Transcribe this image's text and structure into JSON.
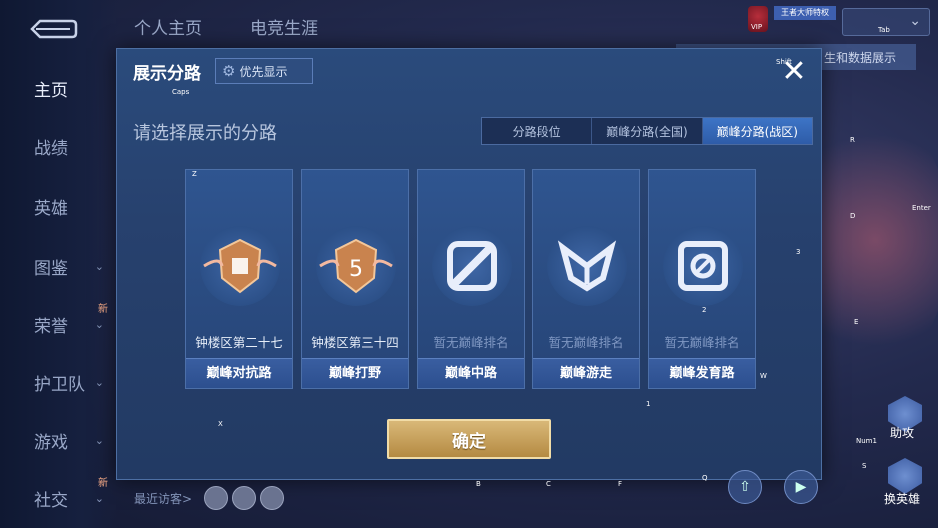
{
  "sidebar": {
    "items": [
      {
        "label": "主页",
        "active": true,
        "chevron": false,
        "new": false
      },
      {
        "label": "战绩",
        "active": false,
        "chevron": false,
        "new": false
      },
      {
        "label": "英雄",
        "active": false,
        "chevron": false,
        "new": false
      },
      {
        "label": "图鉴",
        "active": false,
        "chevron": true,
        "new": false
      },
      {
        "label": "荣誉",
        "active": false,
        "chevron": true,
        "new": true
      },
      {
        "label": "护卫队",
        "active": false,
        "chevron": true,
        "new": false
      },
      {
        "label": "游戏",
        "active": false,
        "chevron": true,
        "new": false
      },
      {
        "label": "社交",
        "active": false,
        "chevron": true,
        "new": true
      }
    ],
    "new_badge": "新"
  },
  "top_tabs": [
    "个人主页",
    "电竞生涯"
  ],
  "top_right": {
    "ribbon_text": "生和数据展示",
    "vip_label": "VIP",
    "banner_text": "王者大师特权"
  },
  "dialog": {
    "title": "展示分路",
    "priority_label": "优先显示",
    "subtitle": "请选择展示的分路",
    "segments": [
      "分路段位",
      "巅峰分路(全国)",
      "巅峰分路(战区)"
    ],
    "selected_segment": 2,
    "cards": [
      {
        "rank": "钟楼区第二十七",
        "lane": "巅峰对抗路",
        "ranked": true,
        "icon": "shield-emblem-2-icon"
      },
      {
        "rank": "钟楼区第三十四",
        "lane": "巅峰打野",
        "ranked": true,
        "icon": "shield-emblem-5-icon"
      },
      {
        "rank": "暂无巅峰排名",
        "lane": "巅峰中路",
        "ranked": false,
        "icon": "mid-lane-icon"
      },
      {
        "rank": "暂无巅峰排名",
        "lane": "巅峰游走",
        "ranked": false,
        "icon": "roam-icon"
      },
      {
        "rank": "暂无巅峰排名",
        "lane": "巅峰发育路",
        "ranked": false,
        "icon": "farm-lane-icon"
      }
    ],
    "confirm_label": "确定"
  },
  "bottom": {
    "recent_visitors": "最近访客>"
  },
  "hotkeys": [
    "Tab",
    "Caps",
    "Shift",
    "Z",
    "X",
    "B",
    "C",
    "F",
    "Q",
    "W",
    "R",
    "D",
    "E",
    "1",
    "2",
    "3",
    "S",
    "Num1",
    "Enter"
  ],
  "right_icons": [
    "助攻",
    "换英雄"
  ]
}
